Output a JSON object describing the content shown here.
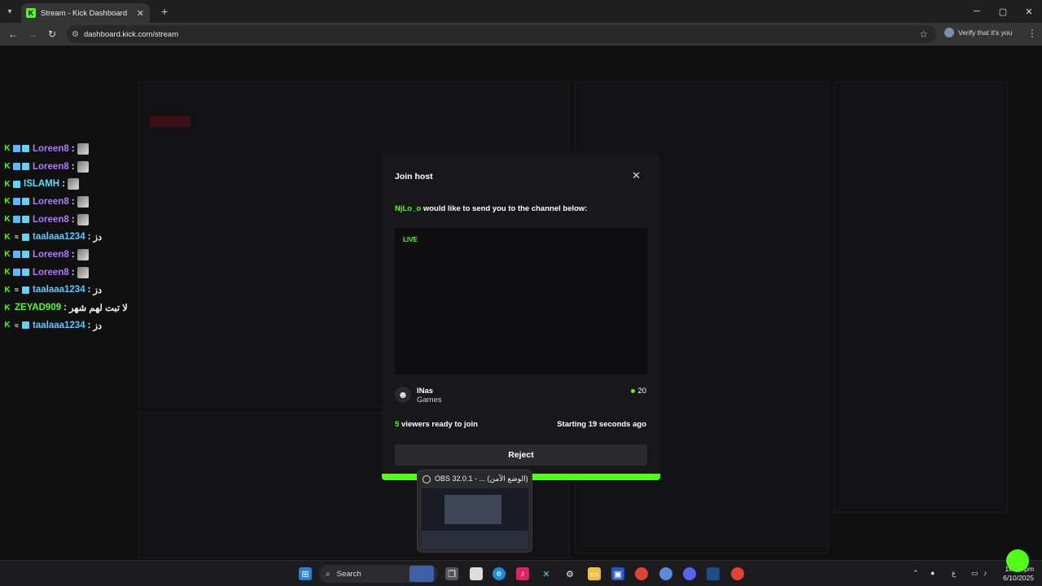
{
  "browser": {
    "tab_title": "Stream - Kick Dashboard",
    "tab_icon": "K",
    "url": "dashboard.kick.com/stream",
    "profile_label": "Verify that it's you"
  },
  "chat": {
    "messages": [
      {
        "user": "Loreen8",
        "color": "#b077ff",
        "message": "",
        "emote": true,
        "badges": [
          "k",
          "prime",
          "sub"
        ]
      },
      {
        "user": "Loreen8",
        "color": "#b077ff",
        "message": "",
        "emote": true,
        "badges": [
          "k",
          "prime",
          "sub"
        ]
      },
      {
        "user": "ISLAMH",
        "color": "#53e0ff",
        "message": "",
        "emote": true,
        "badges": [
          "k",
          "sub"
        ]
      },
      {
        "user": "Loreen8",
        "color": "#b077ff",
        "message": "",
        "emote": true,
        "badges": [
          "k",
          "prime",
          "sub"
        ]
      },
      {
        "user": "Loreen8",
        "color": "#b077ff",
        "message": "",
        "emote": true,
        "badges": [
          "k",
          "prime",
          "sub"
        ]
      },
      {
        "user": "taalaaa1234",
        "color": "#5dc8ff",
        "message": "دز",
        "emote": false,
        "badges": [
          "k",
          "vip",
          "sub"
        ]
      },
      {
        "user": "Loreen8",
        "color": "#b077ff",
        "message": "",
        "emote": true,
        "badges": [
          "k",
          "prime",
          "sub"
        ]
      },
      {
        "user": "Loreen8",
        "color": "#b077ff",
        "message": "",
        "emote": true,
        "badges": [
          "k",
          "prime",
          "sub"
        ]
      },
      {
        "user": "taalaaa1234",
        "color": "#5dc8ff",
        "message": "دز",
        "emote": false,
        "badges": [
          "k",
          "vip",
          "sub"
        ]
      },
      {
        "user": "ZEYAD909",
        "color": "#53fc18",
        "message": "لا تبت لهم شهر",
        "emote": false,
        "badges": [
          "k"
        ]
      },
      {
        "user": "taalaaa1234",
        "color": "#5dc8ff",
        "message": "دز",
        "emote": false,
        "badges": [
          "k",
          "vip",
          "sub"
        ]
      }
    ]
  },
  "modal": {
    "title": "Join host",
    "host_name": "NjLo_o",
    "description": "would like to send you to the channel below:",
    "live_badge": "LIVE",
    "channel_name": "INas",
    "channel_category": "Games",
    "viewer_count": "20",
    "ready_count": "5",
    "ready_text": "viewers ready to join",
    "starting_text": "Starting 19 seconds ago",
    "reject_label": "Reject",
    "progress": 1.0
  },
  "obs_preview": {
    "title": "OBS 32.0.1 - ... (الوضع الآمن)"
  },
  "taskbar": {
    "search_label": "Search",
    "time": "10:23 pm",
    "date": "6/10/2025",
    "lang": "ع"
  },
  "colors": {
    "kick_green": "#53fc18",
    "modal_bg": "#18181a"
  }
}
